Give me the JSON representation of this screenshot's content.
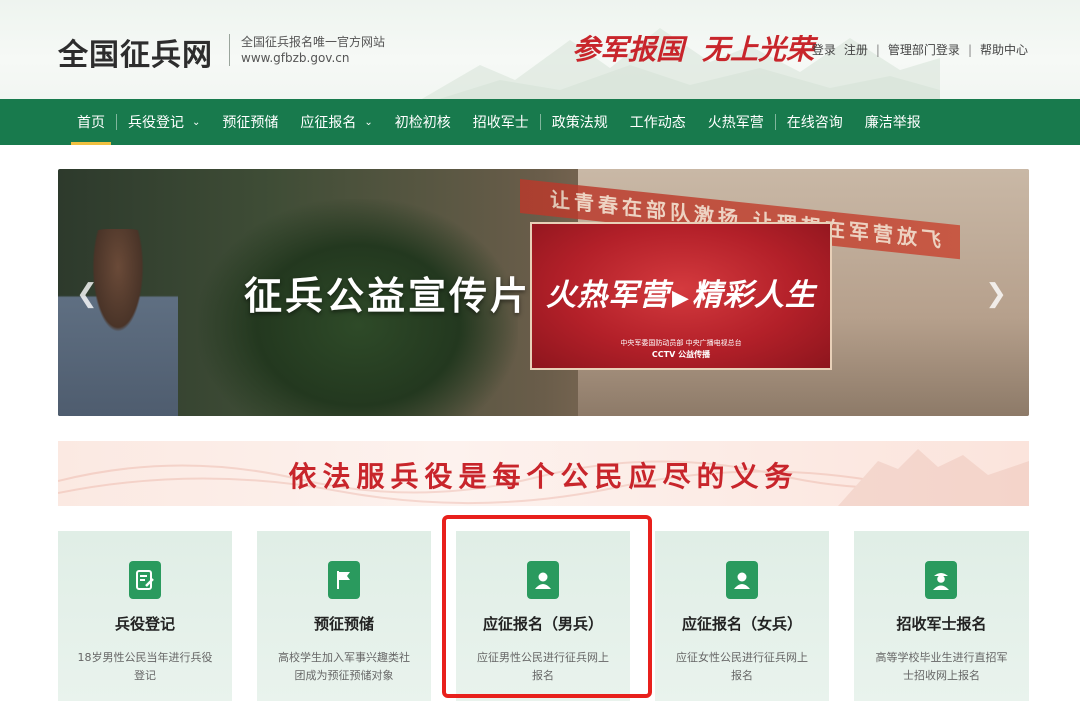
{
  "header": {
    "site_title": "全国征兵网",
    "tagline": "全国征兵报名唯一官方网站",
    "domain": "www.gfbzb.gov.cn",
    "slogan_1": "参军报国",
    "slogan_2": "无上光荣",
    "links": [
      "登录",
      "注册",
      "管理部门登录",
      "帮助中心"
    ]
  },
  "nav": {
    "items": [
      {
        "label": "首页",
        "active": true
      },
      {
        "label": "兵役登记",
        "dropdown": true
      },
      {
        "label": "预征预储"
      },
      {
        "label": "应征报名",
        "dropdown": true
      },
      {
        "label": "初检初核"
      },
      {
        "label": "招收军士"
      },
      {
        "label": "政策法规"
      },
      {
        "label": "工作动态"
      },
      {
        "label": "火热军营"
      },
      {
        "label": "在线咨询"
      },
      {
        "label": "廉洁举报"
      }
    ]
  },
  "banner": {
    "title": "征兵公益宣传片",
    "video_title_left": "火热军营",
    "video_title_right": "精彩人生",
    "video_credit": "中央军委国防动员部  中央广播电视总台",
    "video_credit2": "CCTV  公益传播",
    "bg_sign": "让青春在部队激扬  让理想在军营放飞"
  },
  "motto": "依法服兵役是每个公民应尽的义务",
  "cards": [
    {
      "title": "兵役登记",
      "desc": "18岁男性公民当年进行兵役登记",
      "icon": "form-edit-icon"
    },
    {
      "title": "预征预储",
      "desc": "高校学生加入军事兴趣类社团成为预征预储对象",
      "icon": "flag-icon"
    },
    {
      "title": "应征报名（男兵）",
      "desc": "应征男性公民进行征兵网上报名",
      "icon": "user-icon"
    },
    {
      "title": "应征报名（女兵）",
      "desc": "应征女性公民进行征兵网上报名",
      "icon": "user-icon"
    },
    {
      "title": "招收军士报名",
      "desc": "高等学校毕业生进行直招军士招收网上报名",
      "icon": "soldier-icon"
    }
  ],
  "colors": {
    "nav_green": "#187a4d",
    "accent_red": "#c8252b",
    "highlight_red": "#e8201c",
    "icon_green": "#2a9a5e"
  }
}
